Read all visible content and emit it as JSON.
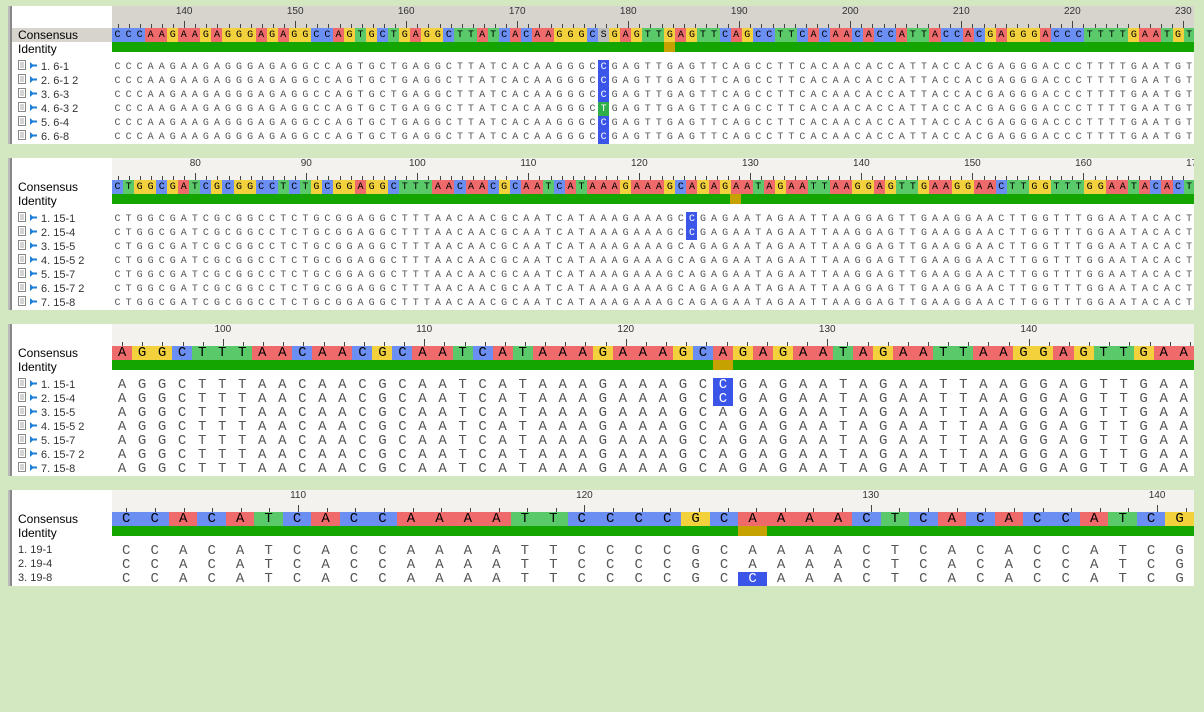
{
  "labels": {
    "consensus": "Consensus",
    "identity": "Identity"
  },
  "icons": {
    "arrow": "arrow-right-icon",
    "doc": "document-icon"
  },
  "colors": {
    "A": "#ef6b6b",
    "T": "#5ac96a",
    "G": "#f2d13c",
    "C": "#6b8ef2",
    "id_match": "#14a500",
    "id_mismatch": "#c6a200",
    "hlC": "#3a55e8",
    "hlT": "#2fae49"
  },
  "panels": [
    {
      "id": "p6",
      "ruler": {
        "start": 134,
        "end": 237,
        "majorEvery": 10,
        "minorEvery": 1,
        "selected": true,
        "firstLabel": 140
      },
      "consensus": "CCCAAGAAGAGGGAGAGGCCAGTGCTGAGGCTTATCACAAGGGCSGAGTTGAGTTCAGCCTTCACAACACCATTACCACGAGGGACCCTTTTGAATGT",
      "identitySplit": 50,
      "rows": [
        {
          "name": "1. 6-1",
          "seq": "CCCAAGAAGAGGGAGAGGCCAGTGCTGAGGCTTATCACAAGGGCCGAGTTGAGTTCAGCCTTCACAACACCATTACCACGAGGGACCCTTTTGAATGT",
          "hl": [
            {
              "i": 44,
              "c": "hlC"
            }
          ]
        },
        {
          "name": "2. 6-1 2",
          "seq": "CCCAAGAAGAGGGAGAGGCCAGTGCTGAGGCTTATCACAAGGGCCGAGTTGAGTTCAGCCTTCACAACACCATTACCACGAGGGACCCTTTTGAATGT",
          "hl": [
            {
              "i": 44,
              "c": "hlC"
            }
          ]
        },
        {
          "name": "3. 6-3",
          "seq": "CCCAAGAAGAGGGAGAGGCCAGTGCTGAGGCTTATCACAAGGGCCGAGTTGAGTTCAGCCTTCACAACACCATTACCACGAGGGACCCTTTTGAATGT",
          "hl": [
            {
              "i": 44,
              "c": "hlC"
            }
          ]
        },
        {
          "name": "4. 6-3 2",
          "seq": "CCCAAGAAGAGGGAGAGGCCAGTGCTGAGGCTTATCACAAGGGCTGAGTTGAGTTCAGCCTTCACAACACCATTACCACGAGGGACCCTTTTGAATGT",
          "hl": [
            {
              "i": 44,
              "c": "hlT"
            }
          ]
        },
        {
          "name": "5. 6-4",
          "seq": "CCCAAGAAGAGGGAGAGGCCAGTGCTGAGGCTTATCACAAGGGCCGAGTTGAGTTCAGCCTTCACAACACCATTACCACGAGGGACCCTTTTGAATGT",
          "hl": [
            {
              "i": 44,
              "c": "hlC"
            }
          ]
        },
        {
          "name": "6. 6-8",
          "seq": "CCCAAGAAGAGGGAGAGGCCAGTGCTGAGGCTTATCACAAGGGCCGAGTTGAGTTCAGCCTTCACAACACCATTACCACGAGGGACCCTTTTGAATGT",
          "hl": [
            {
              "i": 44,
              "c": "hlC"
            }
          ]
        }
      ]
    },
    {
      "id": "p15",
      "ruler": {
        "start": 73,
        "end": 172,
        "majorEvery": 10,
        "minorEvery": 1,
        "selected": false,
        "firstLabel": 80
      },
      "consensus": "CTGGCGATCGCGGCCTCTGCGGAGGCTTTAACAACGCAATCATAAAGAAAGCAGAGAATAGAATTAAGGAGTTGAAGGAACTTGGTTTGGAATACACT",
      "identitySplit": 56,
      "rows": [
        {
          "name": "1. 15-1",
          "seq": "CTGGCGATCGCGGCCTCTGCGGAGGCTTTAACAACGCAATCATAAAGAAAGCCGAGAATAGAATTAAGGAGTTGAAGGAACTTGGTTTGGAATACACT",
          "hl": [
            {
              "i": 52,
              "c": "hlC"
            }
          ]
        },
        {
          "name": "2. 15-4",
          "seq": "CTGGCGATCGCGGCCTCTGCGGAGGCTTTAACAACGCAATCATAAAGAAAGCCGAGAATAGAATTAAGGAGTTGAAGGAACTTGGTTTGGAATACACT",
          "hl": [
            {
              "i": 52,
              "c": "hlC"
            }
          ]
        },
        {
          "name": "3. 15-5",
          "seq": "CTGGCGATCGCGGCCTCTGCGGAGGCTTTAACAACGCAATCATAAAGAAAGCAGAGAATAGAATTAAGGAGTTGAAGGAACTTGGTTTGGAATACACT",
          "hl": []
        },
        {
          "name": "4. 15-5 2",
          "seq": "CTGGCGATCGCGGCCTCTGCGGAGGCTTTAACAACGCAATCATAAAGAAAGCAGAGAATAGAATTAAGGAGTTGAAGGAACTTGGTTTGGAATACACT",
          "hl": []
        },
        {
          "name": "5. 15-7",
          "seq": "CTGGCGATCGCGGCCTCTGCGGAGGCTTTAACAACGCAATCATAAAGAAAGCAGAGAATAGAATTAAGGAGTTGAAGGAACTTGGTTTGGAATACACT",
          "hl": []
        },
        {
          "name": "6. 15-7 2",
          "seq": "CTGGCGATCGCGGCCTCTGCGGAGGCTTTAACAACGCAATCATAAAGAAAGCAGAGAATAGAATTAAGGAGTTGAAGGAACTTGGTTTGGAATACACT",
          "hl": []
        },
        {
          "name": "7. 15-8",
          "seq": "CTGGCGATCGCGGCCTCTGCGGAGGCTTTAACAACGCAATCATAAAGAAAGCAGAGAATAGAATTAAGGAGTTGAAGGAACTTGGTTTGGAATACACT",
          "hl": []
        }
      ]
    },
    {
      "id": "p15b",
      "ruler": {
        "start": 95,
        "end": 148,
        "majorEvery": 10,
        "minorEvery": 1,
        "selected": false,
        "firstLabel": 100
      },
      "consensus": "AGGCTTTAACAACGCAATCATAAAGAAAGCAGAGAATAGAATTAAGGAGTTGAA",
      "identitySplit": 30,
      "rows": [
        {
          "name": "1. 15-1",
          "seq": "AGGCTTTAACAACGCAATCATAAAGAAAGCCGAGAATAGAATTAAGGAGTTGAA",
          "hl": [
            {
              "i": 30,
              "c": "hlC"
            }
          ]
        },
        {
          "name": "2. 15-4",
          "seq": "AGGCTTTAACAACGCAATCATAAAGAAAGCCGAGAATAGAATTAAGGAGTTGAA",
          "hl": [
            {
              "i": 30,
              "c": "hlC"
            }
          ]
        },
        {
          "name": "3. 15-5",
          "seq": "AGGCTTTAACAACGCAATCATAAAGAAAGCAGAGAATAGAATTAAGGAGTTGAA",
          "hl": []
        },
        {
          "name": "4. 15-5 2",
          "seq": "AGGCTTTAACAACGCAATCATAAAGAAAGCAGAGAATAGAATTAAGGAGTTGAA",
          "hl": []
        },
        {
          "name": "5. 15-7",
          "seq": "AGGCTTTAACAACGCAATCATAAAGAAAGCAGAGAATAGAATTAAGGAGTTGAA",
          "hl": []
        },
        {
          "name": "6. 15-7 2",
          "seq": "AGGCTTTAACAACGCAATCATAAAGAAAGCAGAGAATAGAATTAAGGAGTTGAA",
          "hl": []
        },
        {
          "name": "7. 15-8",
          "seq": "AGGCTTTAACAACGCAATCATAAAGAAAGCAGAGAATAGAATTAAGGAGTTGAA",
          "hl": []
        }
      ]
    },
    {
      "id": "p19",
      "ruler": {
        "start": 104,
        "end": 141,
        "majorEvery": 10,
        "minorEvery": 1,
        "selected": false,
        "firstLabel": 110
      },
      "consensus": "CCACATCACCAAAATTCCCCGCAAAACTCACACCATCG",
      "identitySplit": 22,
      "noIcons": true,
      "rows": [
        {
          "name": "1. 19-1",
          "seq": "CCACATCACCAAAATTCCCCGCAAAACTCACACCATCG",
          "hl": []
        },
        {
          "name": "2. 19-4",
          "seq": "CCACATCACCAAAATTCCCCGCAAAACTCACACCATCG",
          "hl": []
        },
        {
          "name": "3. 19-8",
          "seq": "CCACATCACCAAAATTCCCCGCCAAACTCACACCATCG",
          "hl": [
            {
              "i": 22,
              "c": "hlC"
            }
          ]
        }
      ]
    }
  ]
}
